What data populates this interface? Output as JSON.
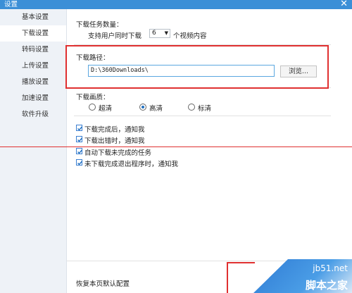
{
  "window": {
    "title": "设置",
    "close_glyph": "✕"
  },
  "sidebar": {
    "items": [
      {
        "label": "基本设置"
      },
      {
        "label": "下载设置"
      },
      {
        "label": "转码设置"
      },
      {
        "label": "上传设置"
      },
      {
        "label": "播放设置"
      },
      {
        "label": "加速设置"
      },
      {
        "label": "软件升级"
      }
    ],
    "active_index": 1
  },
  "download_tasks": {
    "heading": "下载任务数量：",
    "prefix": "支持用户同时下载",
    "value": "6",
    "suffix": "个视频内容"
  },
  "download_path": {
    "heading": "下载路径：",
    "value": "D:\\360Downloads\\",
    "browse_label": "浏览..."
  },
  "quality": {
    "heading": "下载画质：",
    "options": [
      {
        "label": "超清",
        "checked": false
      },
      {
        "label": "高清",
        "checked": true
      },
      {
        "label": "标清",
        "checked": false
      }
    ]
  },
  "notifications": {
    "items": [
      {
        "label": "下载完成后，通知我",
        "checked": true
      },
      {
        "label": "下载出错时，通知我",
        "checked": true
      },
      {
        "label": "自动下载未完成的任务",
        "checked": true
      },
      {
        "label": "未下载完成退出程序时，通知我",
        "checked": true
      }
    ]
  },
  "footer": {
    "reset_label": "恢复本页默认配置"
  },
  "watermark": {
    "site": "jb51.net",
    "brand": "脚本之家"
  },
  "colors": {
    "titlebar": "#3b8fd7",
    "annotation": "#e03030",
    "accent": "#1f6fc0"
  }
}
